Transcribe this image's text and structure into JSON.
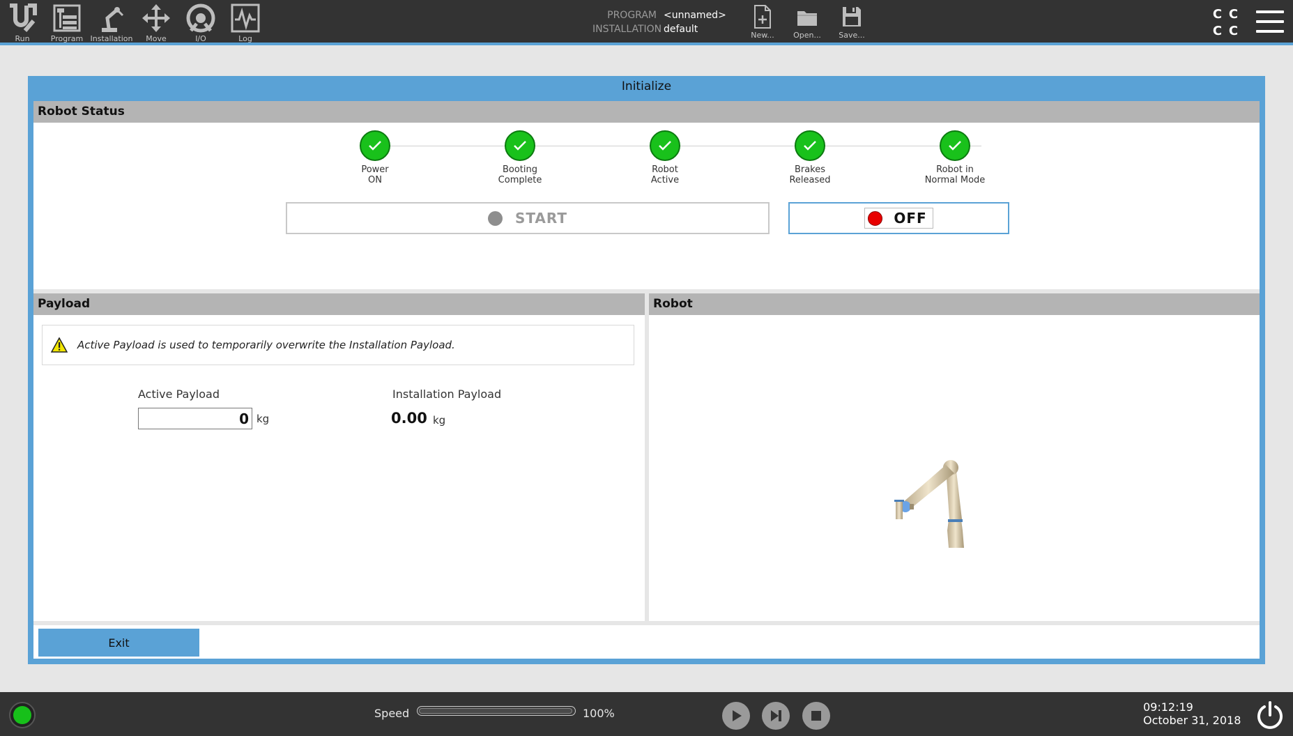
{
  "topbar": {
    "nav": [
      {
        "label": "Run",
        "icon": "ur-logo-icon"
      },
      {
        "label": "Program",
        "icon": "program-icon"
      },
      {
        "label": "Installation",
        "icon": "installation-icon"
      },
      {
        "label": "Move",
        "icon": "move-icon"
      },
      {
        "label": "I/O",
        "icon": "io-icon"
      },
      {
        "label": "Log",
        "icon": "log-icon"
      }
    ],
    "program_key": "PROGRAM",
    "program_value": "<unnamed>",
    "installation_key": "INSTALLATION",
    "installation_value": "default",
    "new_label": "New...",
    "open_label": "Open...",
    "save_label": "Save...",
    "cc": [
      "C",
      "C",
      "C",
      "C"
    ]
  },
  "dialog": {
    "title": "Initialize",
    "robot_status": {
      "heading": "Robot Status",
      "steps": [
        {
          "line1": "Power",
          "line2": "ON",
          "done": true
        },
        {
          "line1": "Booting",
          "line2": "Complete",
          "done": true
        },
        {
          "line1": "Robot",
          "line2": "Active",
          "done": true
        },
        {
          "line1": "Brakes",
          "line2": "Released",
          "done": true
        },
        {
          "line1": "Robot in",
          "line2": "Normal Mode",
          "done": true
        }
      ],
      "start_label": "START",
      "off_label": "OFF"
    },
    "payload": {
      "heading": "Payload",
      "warning": "Active Payload is used to temporarily overwrite the Installation Payload.",
      "active_label": "Active Payload",
      "active_value": "0",
      "active_unit": "kg",
      "installation_label": "Installation Payload",
      "installation_value": "0.00",
      "installation_unit": "kg"
    },
    "robot": {
      "heading": "Robot"
    },
    "exit_label": "Exit"
  },
  "footer": {
    "speed_label": "Speed",
    "speed_value": "100%",
    "speed_fraction": 1.0,
    "time": "09:12:19",
    "date": "October 31, 2018"
  },
  "colors": {
    "accent": "#5aa2d6",
    "topbar": "#333333",
    "ok_green": "#19c11b",
    "off_red": "#e80000"
  }
}
